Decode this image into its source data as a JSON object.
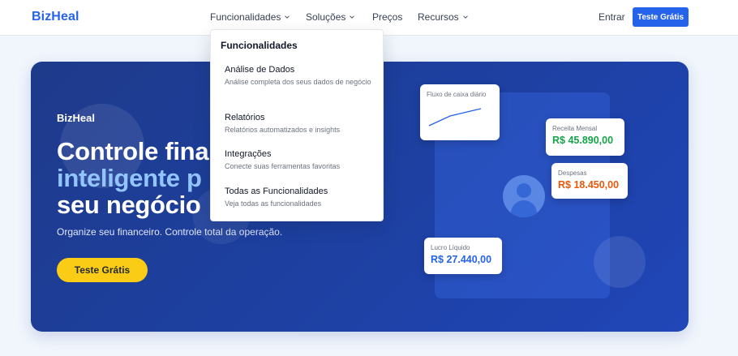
{
  "navbar": {
    "logo": "BizHeal",
    "items": [
      {
        "label": "Funcionalidades",
        "has_dropdown": true
      },
      {
        "label": "Soluções",
        "has_dropdown": true
      },
      {
        "label": "Preços",
        "has_dropdown": false
      },
      {
        "label": "Recursos",
        "has_dropdown": true
      }
    ],
    "login_label": "Entrar",
    "cta_label": "Teste Grátis"
  },
  "dropdown": {
    "title": "Funcionalidades",
    "items": [
      {
        "title": "Análise de Dados",
        "description": "Análise completa dos seus dados de negócio"
      },
      {
        "title": "Relatórios",
        "description": "Relatórios automatizados e insights"
      },
      {
        "title": "Integrações",
        "description": "Conecte suas ferramentas favoritas"
      },
      {
        "title": "Todas as Funcionalidades",
        "description": "Veja todas as funcionalidades"
      }
    ]
  },
  "hero": {
    "brand": "BizHeal",
    "title_line1": "Controle fina",
    "title_line2": "inteligente p",
    "title_line3": "seu negócio",
    "subtitle": "Organize seu financeiro. Controle total da operação.",
    "cta_label": "Teste Grátis",
    "cards": {
      "flow_label": "Fluxo de caixa diário",
      "revenue_label": "Receita Mensal",
      "revenue_value": "R$ 45.890,00",
      "expenses_label": "Despesas",
      "expenses_value": "R$ 18.450,00",
      "profit_label": "Lucro Líquido",
      "profit_value": "R$ 27.440,00"
    }
  },
  "colors": {
    "brand": "#2563eb",
    "hero_bg": "#1e3a8a",
    "cta_yellow": "#facc15",
    "revenue": "#16a34a",
    "expenses": "#ea580c",
    "profit": "#2563eb"
  },
  "icons": [
    "chevron-down-icon",
    "user-avatar-icon",
    "line-chart-icon"
  ]
}
